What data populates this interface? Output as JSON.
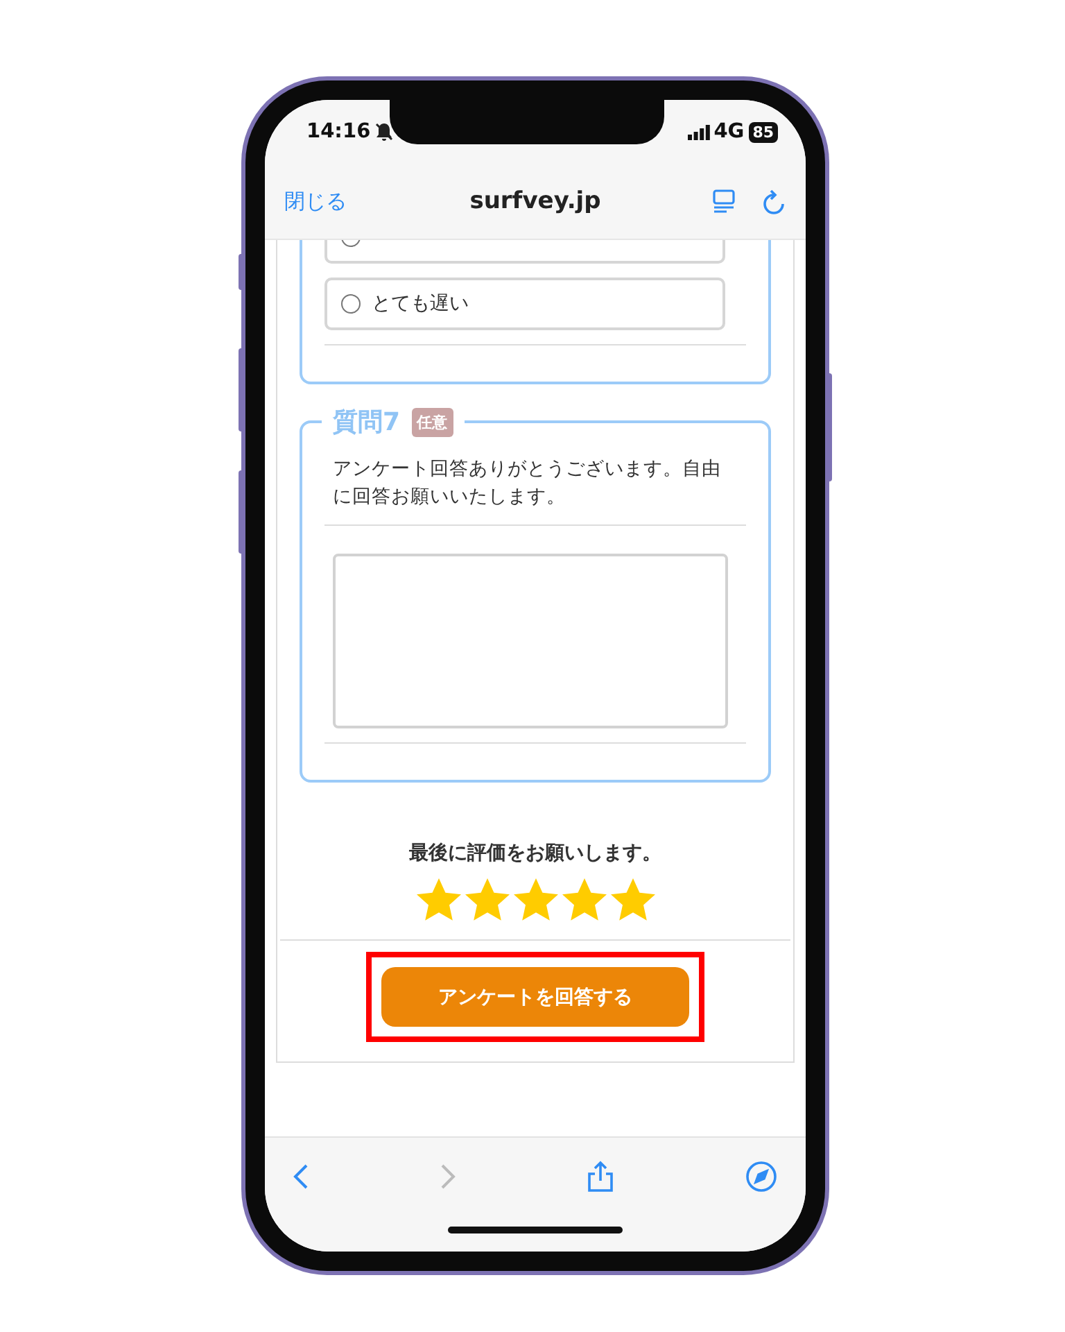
{
  "status_bar": {
    "time": "14:16",
    "network": "4G",
    "battery": "85",
    "silent": true
  },
  "browser_bar": {
    "close": "閉じる",
    "title": "surfvey.jp"
  },
  "previous_question": {
    "options": [
      {
        "selected": false
      },
      {
        "label": "とても遅い",
        "selected": false
      }
    ]
  },
  "question": {
    "title": "質問7",
    "badge": "任意",
    "text": "アンケート回答ありがとうございます。自由に回答お願いいたします。"
  },
  "rating": {
    "prompt": "最後に評価をお願いします。",
    "stars": 5
  },
  "submit_button": {
    "label": "アンケートを回答する",
    "highlighted": true
  }
}
